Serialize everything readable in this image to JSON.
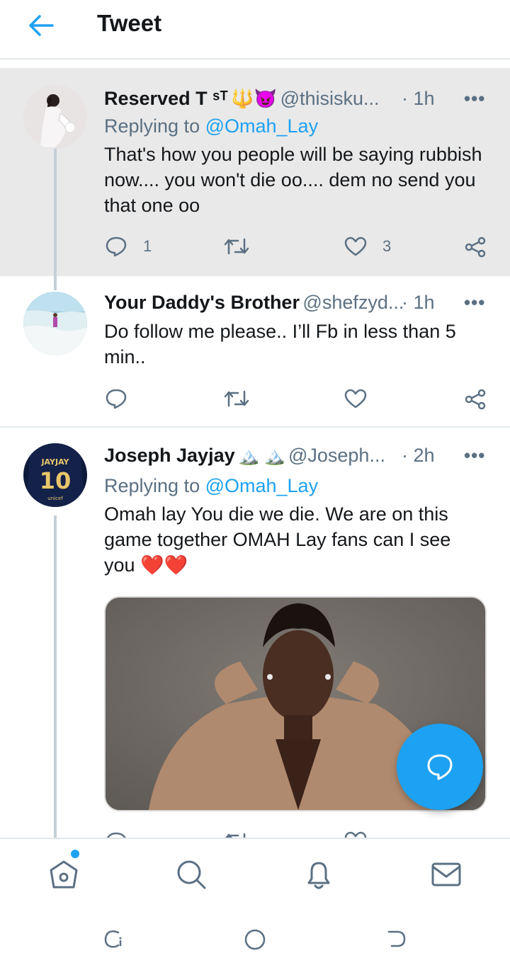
{
  "header": {
    "title": "Tweet"
  },
  "tweets": [
    {
      "name": "Reserved T ˢᵀ",
      "emojis": "🔱😈",
      "handle": "@thisisku...",
      "time": "· 1h",
      "replying_prefix": "Replying to ",
      "replying_to": "@Omah_Lay",
      "text": "That's how you people will be saying rubbish now.... you won't die oo.... dem no send you that one oo",
      "replies": "1",
      "retweets": "",
      "likes": "3"
    },
    {
      "name": "Your Daddy's Brother",
      "handle": "@shefzyd...",
      "time": "· 1h",
      "text": "Do follow me please.. I’ll Fb in less than 5 min..",
      "replies": "",
      "retweets": "",
      "likes": ""
    },
    {
      "name": "Joseph Jayjay",
      "emojis": "🏔️ 🏔️",
      "handle": "@Joseph...",
      "time": "· 2h",
      "replying_prefix": "Replying to ",
      "replying_to": "@Omah_Lay",
      "text": "Omah lay You die we die. We are on this game together OMAH Lay fans can I see you",
      "text_emojis": "❤️❤️",
      "jersey_name": "JAYJAY",
      "jersey_number": "10",
      "jersey_sponsor": "unicef"
    }
  ],
  "more_label": "•••",
  "colors": {
    "accent": "#1da1f2",
    "secondary": "#5b7083",
    "highlight_bg": "#e9e9e9",
    "heart": "#e0245e"
  },
  "icons": {
    "back": "arrow-left-icon",
    "reply": "reply-bubble-icon",
    "retweet": "retweet-icon",
    "like": "heart-icon",
    "share": "share-icon",
    "compose": "compose-reply-icon",
    "home": "home-icon",
    "search": "search-icon",
    "notifications": "bell-icon",
    "messages": "envelope-icon"
  }
}
